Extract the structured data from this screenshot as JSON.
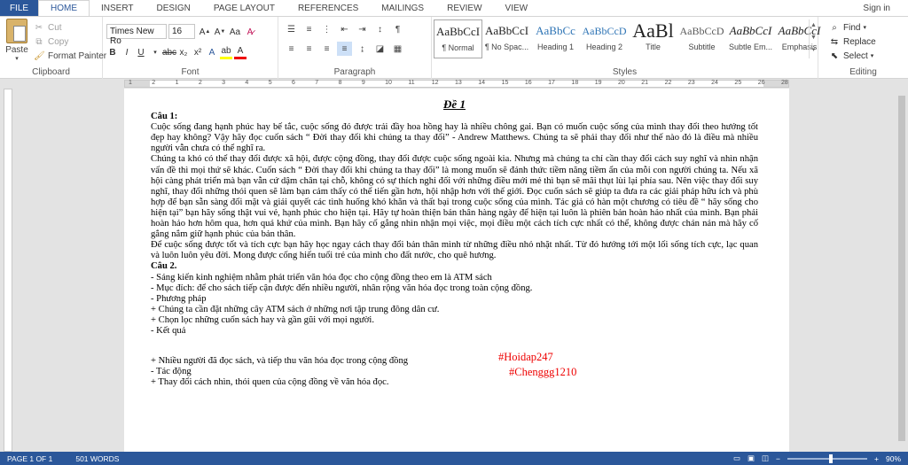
{
  "tabs": {
    "file": "FILE",
    "items": [
      "HOME",
      "INSERT",
      "DESIGN",
      "PAGE LAYOUT",
      "REFERENCES",
      "MAILINGS",
      "REVIEW",
      "VIEW"
    ],
    "active_index": 0,
    "signin": "Sign in"
  },
  "clipboard": {
    "paste": "Paste",
    "cut": "Cut",
    "copy": "Copy",
    "format_painter": "Format Painter",
    "label": "Clipboard"
  },
  "font": {
    "name": "Times New Ro",
    "size": "16",
    "label": "Font"
  },
  "paragraph": {
    "label": "Paragraph"
  },
  "styles": {
    "label": "Styles",
    "items": [
      {
        "preview": "AaBbCcI",
        "name": "¶ Normal"
      },
      {
        "preview": "AaBbCcI",
        "name": "¶ No Spac..."
      },
      {
        "preview": "AaBbCc",
        "name": "Heading 1"
      },
      {
        "preview": "AaBbCcD",
        "name": "Heading 2"
      },
      {
        "preview": "AaBl",
        "name": "Title"
      },
      {
        "preview": "AaBbCcD",
        "name": "Subtitle"
      },
      {
        "preview": "AaBbCcI",
        "name": "Subtle Em..."
      },
      {
        "preview": "AaBbCcI",
        "name": "Emphasis"
      }
    ]
  },
  "editing": {
    "find": "Find",
    "replace": "Replace",
    "select": "Select",
    "label": "Editing"
  },
  "ruler": {
    "numbers": [
      "1",
      "2",
      "1",
      "2",
      "3",
      "4",
      "5",
      "6",
      "7",
      "8",
      "9",
      "10",
      "11",
      "12",
      "13",
      "14",
      "15",
      "16",
      "17",
      "18",
      "19",
      "20",
      "21",
      "22",
      "23",
      "24",
      "25",
      "26",
      "28"
    ]
  },
  "document": {
    "title": "Đề 1",
    "q1_heading": "Câu 1:",
    "p1": "Cuộc sống đang hạnh phúc hay bế tắc, cuộc sống đó được trải đầy hoa hồng hay là nhiều chông gai. Bạn có muốn cuộc sống của mình thay đổi theo hướng tốt đẹp hay không? Vậy hãy đọc cuốn sách “ Đời thay đổi khi chúng ta thay đổi” - Andrew Matthews. Chúng ta sẽ phải thay đổi như thế nào đó là điều mà nhiều người vẫn chưa có thể nghĩ ra.",
    "p2": "Chúng ta khó có thể thay đổi được xã hội, được cộng đồng, thay đổi được cuộc sống ngoài kia. Nhưng mà chúng ta chỉ cần thay đổi cách suy nghĩ và nhìn nhận vấn đề thì mọi thứ sẽ khác. Cuốn sách “ Đời thay đổi khi chúng ta thay đổi” là  mong muốn sẽ đánh thức tiềm năng tiềm ẩn của mỗi con người chúng ta. Nếu xã hội càng phát triển mà bạn vẫn cứ dậm chân tại chỗ, không có sự thích nghi đối với những điều mới mẻ thì bạn sẽ mãi thụt lùi lại phía sau. Nên việc thay đổi suy nghĩ, thay đổi những thói quen sẽ làm bạn cảm thấy có thể tiến gần hơn, hội nhập hơn với thế giới. Đọc cuốn sách sẽ giúp ta đưa ra các giải pháp hữu ích và phù hợp để bạn sẵn sàng đối mặt và giải quyết các tình huống khó khăn và thất bại trong cuộc sống của mình. Tác giả có hàn một chương có tiêu đề “ hãy sống cho hiện tại” bạn hãy sống thật vui vẻ, hạnh phúc cho hiện tại. Hãy tự hoàn thiện bản thân hàng ngày để hiện tại luôn là phiên bản hoàn hảo nhất của mình. Bạn phải hoàn hảo hơn hôm qua, hơn quá khứ của mình. Bạn hãy cố gắng nhìn nhận mọi việc, mọi điều một cách tích cực nhất có thể, không được chán nản mà hãy cố gắng nắm giữ hạnh phúc của bản thân.",
    "p3": "Để cuộc sống được tốt và tích cực bạn hãy học ngay cách thay đổi bản thân mình từ những điều nhỏ nhặt nhất. Từ đó hướng tới một lối sống tích cực, lạc quan  và luôn luôn yêu đời. Mong được cống hiến tuổi trẻ của mình cho đất nước, cho quê hương.",
    "q2_heading": "Câu 2.",
    "lines": [
      "- Sáng kiến kinh nghiệm nhằm phát triển văn hóa đọc cho cộng đồng theo em là ATM sách",
      "- Mục đích: để cho sách tiếp cận được đến nhiều người, nhân rộng văn hóa đọc trong toàn cộng đồng.",
      "- Phương pháp",
      "+ Chúng ta cần đặt những cây ATM sách ở những nơi tập trung đông dân cư.",
      "+ Chọn lọc những cuốn sách hay và gần gũi với mọi người.",
      "- Kết quả"
    ],
    "lines_after": [
      "+ Nhiều người đã đọc sách, và tiếp thu văn hóa đọc trong cộng đồng",
      "- Tác động",
      "+ Thay đổi cách nhìn, thói quen của cộng đồng về văn hóa đọc."
    ],
    "tag1": "#Hoidap247",
    "tag2": "#Chenggg1210"
  },
  "status": {
    "page": "PAGE 1 OF 1",
    "words": "501 WORDS",
    "zoom": "90%",
    "zoom_fraction": 0.55
  }
}
